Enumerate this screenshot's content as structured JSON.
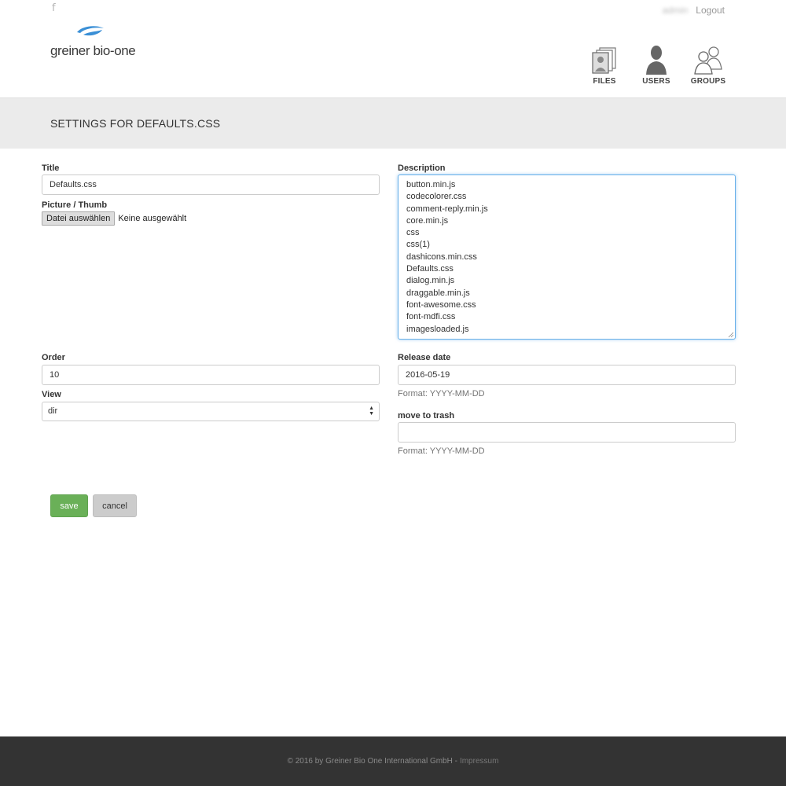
{
  "header": {
    "facebook_icon": "f",
    "username": "admin",
    "logout_label": "Logout",
    "logo_text": "greiner bio-one",
    "nav": [
      {
        "label": "FILES",
        "icon": "files-icon"
      },
      {
        "label": "USERS",
        "icon": "user-icon"
      },
      {
        "label": "GROUPS",
        "icon": "groups-icon"
      }
    ]
  },
  "page_title": "SETTINGS FOR DEFAULTS.CSS",
  "form": {
    "title_label": "Title",
    "title_value": "Defaults.css",
    "picture_label": "Picture / Thumb",
    "file_button": "Datei auswählen",
    "file_status": "Keine ausgewählt",
    "description_label": "Description",
    "description_lines": [
      "button.min.js",
      "codecolorer.css",
      "comment-reply.min.js",
      "core.min.js",
      "css",
      "css(1)",
      "dashicons.min.css",
      "Defaults.css",
      "dialog.min.js",
      "draggable.min.js",
      "font-awesome.css",
      "font-mdfi.css",
      "imagesloaded.js"
    ],
    "order_label": "Order",
    "order_value": "10",
    "view_label": "View",
    "view_value": "dir",
    "release_label": "Release date",
    "release_value": "2016-05-19",
    "release_help": "Format: YYYY-MM-DD",
    "trash_label": "move to trash",
    "trash_value": "",
    "trash_help": "Format: YYYY-MM-DD",
    "save_label": "save",
    "cancel_label": "cancel"
  },
  "footer": {
    "copyright": "© 2016 by Greiner Bio One International GmbH -",
    "impressum": "Impressum"
  },
  "colors": {
    "accent_blue": "#3a8fd6",
    "save_green": "#6ab058",
    "focus_blue": "#66afe9",
    "footer_bg": "#333333"
  }
}
